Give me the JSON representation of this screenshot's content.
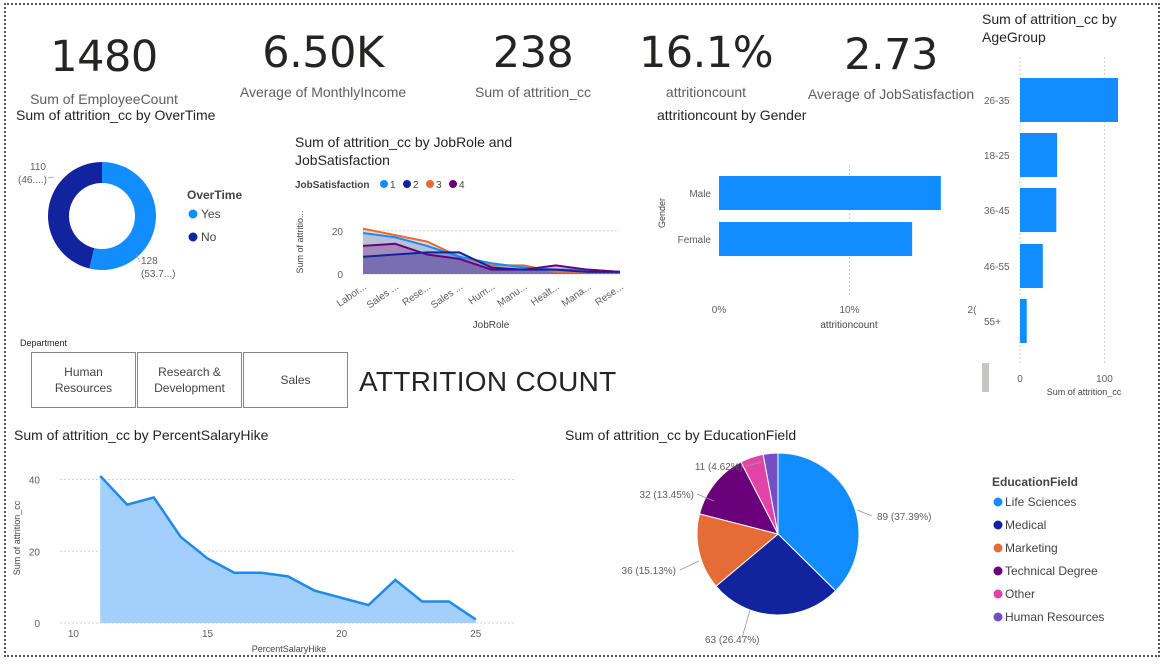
{
  "kpis": [
    {
      "value": "1480",
      "label": "Sum of EmployeeCount"
    },
    {
      "value": "6.50K",
      "label": "Average of MonthlyIncome"
    },
    {
      "value": "238",
      "label": "Sum of attrition_cc"
    },
    {
      "value": "16.1%",
      "label": "attritioncount"
    },
    {
      "value": "2.73",
      "label": "Average of JobSatisfaction"
    }
  ],
  "slicer": {
    "title": "Department",
    "options": [
      "Human Resources",
      "Research & Development",
      "Sales"
    ]
  },
  "page_title": "ATTRITION COUNT",
  "colors": {
    "blue": "#118dff",
    "navy": "#12239e",
    "orange": "#e66c37",
    "purple": "#6b007b",
    "pink": "#e044a7",
    "violet": "#744ec2",
    "light_blue_fill": "#a3cffc"
  },
  "chart_data": [
    {
      "id": "overtime",
      "type": "pie",
      "title": "Sum of attrition_cc by OverTime",
      "legend_title": "OverTime",
      "categories": [
        "Yes",
        "No"
      ],
      "values": [
        128,
        110
      ],
      "data_labels": [
        "128 (53.7...)",
        "110 (46....)"
      ],
      "legend_position": "right"
    },
    {
      "id": "jobrole",
      "type": "area",
      "title": "Sum of attrition_cc by JobRole and JobSatisfaction",
      "legend_title": "JobSatisfaction",
      "xlabel": "JobRole",
      "ylabel": "Sum of attritio...",
      "categories": [
        "Labor...",
        "Sales ...",
        "Rese...",
        "Sales ...",
        "Hum...",
        "Manu...",
        "Healt...",
        "Mana...",
        "Rese..."
      ],
      "yticks": [
        0,
        20
      ],
      "ylim": [
        0,
        25
      ],
      "series": [
        {
          "name": "1",
          "values": [
            19,
            17,
            13,
            8,
            5,
            3,
            2,
            2,
            1
          ]
        },
        {
          "name": "2",
          "values": [
            8,
            9,
            10,
            10,
            3,
            2,
            2,
            1,
            1
          ]
        },
        {
          "name": "3",
          "values": [
            21,
            18,
            15,
            8,
            4,
            4,
            1,
            1,
            1
          ]
        },
        {
          "name": "4",
          "values": [
            13,
            14,
            9,
            7,
            2,
            2,
            4,
            2,
            1
          ]
        }
      ],
      "legend_position": "top"
    },
    {
      "id": "gender",
      "type": "bar",
      "orientation": "horizontal",
      "title": "attritioncount by Gender",
      "xlabel": "attritioncount",
      "ylabel": "Gender",
      "categories": [
        "Male",
        "Female"
      ],
      "values": [
        0.17,
        0.148
      ],
      "xticks": [
        "0%",
        "10%",
        "2("
      ],
      "xlim": [
        0,
        0.2
      ]
    },
    {
      "id": "agegroup",
      "type": "bar",
      "orientation": "horizontal",
      "title": "Sum of attrition_cc by AgeGroup",
      "xlabel": "Sum of attrition_cc",
      "categories": [
        "26-35",
        "18-25",
        "36-45",
        "46-55",
        "55+"
      ],
      "values": [
        116,
        44,
        43,
        27,
        8
      ],
      "xticks": [
        "0",
        "100"
      ],
      "xlim": [
        0,
        130
      ]
    },
    {
      "id": "salaryhike",
      "type": "area",
      "title": "Sum of attrition_cc by PercentSalaryHike",
      "xlabel": "PercentSalaryHike",
      "ylabel": "Sum of attrition_cc",
      "x": [
        11,
        12,
        13,
        14,
        15,
        16,
        17,
        18,
        19,
        20,
        21,
        22,
        23,
        24,
        25
      ],
      "values": [
        41,
        33,
        35,
        24,
        18,
        14,
        14,
        13,
        9,
        7,
        5,
        12,
        6,
        6,
        1
      ],
      "xticks": [
        10,
        15,
        20,
        25
      ],
      "yticks": [
        0,
        20,
        40
      ],
      "xlim": [
        9.5,
        26.5
      ],
      "ylim": [
        0,
        46
      ]
    },
    {
      "id": "education",
      "type": "pie",
      "title": "Sum of attrition_cc by EducationField",
      "legend_title": "EducationField",
      "categories": [
        "Life Sciences",
        "Medical",
        "Marketing",
        "Technical Degree",
        "Other",
        "Human Resources"
      ],
      "values": [
        89,
        63,
        36,
        32,
        11,
        7
      ],
      "data_labels": [
        "89 (37.39%)",
        "63 (26.47%)",
        "36 (15.13%)",
        "32 (13.45%)",
        "11 (4.62%)",
        ""
      ],
      "legend_position": "right"
    }
  ]
}
